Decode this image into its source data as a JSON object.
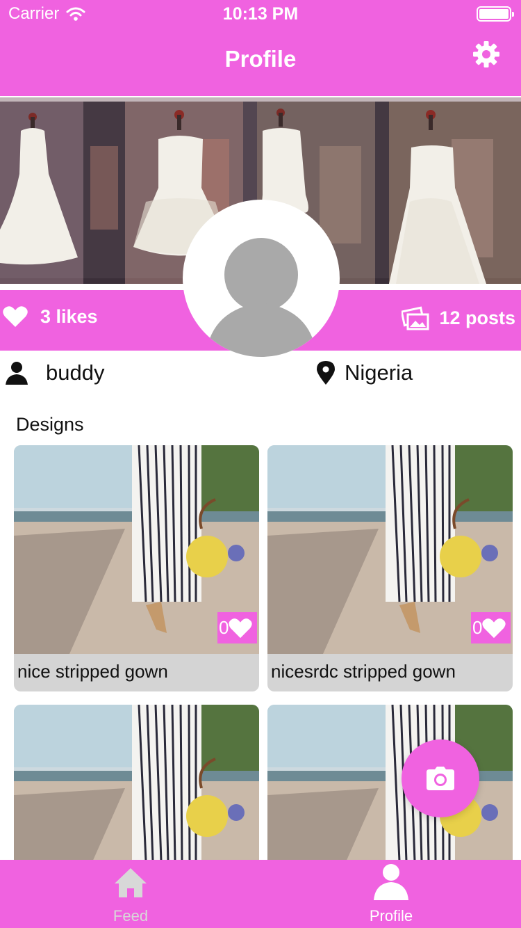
{
  "status_bar": {
    "carrier": "Carrier",
    "time": "10:13 PM"
  },
  "nav": {
    "title": "Profile",
    "settings_icon": "gear-icon"
  },
  "profile": {
    "likes_label": "3 likes",
    "posts_label": "12 posts",
    "username": "buddy",
    "location": "Nigeria"
  },
  "designs": {
    "title": "Designs",
    "items": [
      {
        "caption": "nice stripped gown",
        "likes": "0"
      },
      {
        "caption": "nicesrdc stripped gown",
        "likes": "0"
      },
      {
        "caption": "",
        "likes": ""
      },
      {
        "caption": "",
        "likes": ""
      }
    ]
  },
  "tabs": [
    {
      "label": "Feed",
      "icon": "home-icon",
      "active": false
    },
    {
      "label": "Profile",
      "icon": "person-icon",
      "active": true
    }
  ],
  "colors": {
    "accent": "#f062e0",
    "inactive_tab": "#d8d8d8",
    "card_bg": "#d4d4d4"
  }
}
